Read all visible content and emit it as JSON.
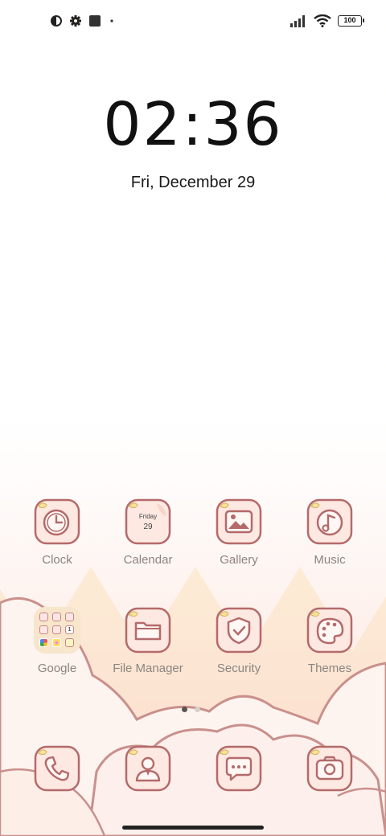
{
  "status_bar": {
    "battery": "100",
    "left_icons": [
      "theme-icon",
      "settings-icon",
      "stop-square-icon",
      "dot-icon"
    ],
    "right_icons": [
      "signal-icon",
      "wifi-icon",
      "battery-icon"
    ]
  },
  "lockscreen": {
    "time": "02:36",
    "date": "Fri, December 29"
  },
  "apps": [
    {
      "label": "Clock",
      "icon": "clock-icon"
    },
    {
      "label": "Calendar",
      "icon": "calendar-icon",
      "day_name": "Friday",
      "day_num": "29"
    },
    {
      "label": "Gallery",
      "icon": "gallery-icon"
    },
    {
      "label": "Music",
      "icon": "music-icon"
    },
    {
      "label": "Google",
      "icon": "folder-icon"
    },
    {
      "label": "File Manager",
      "icon": "folder-icon"
    },
    {
      "label": "Security",
      "icon": "shield-icon"
    },
    {
      "label": "Themes",
      "icon": "palette-icon"
    }
  ],
  "folder_badge": "1",
  "dock": [
    {
      "icon": "phone-icon"
    },
    {
      "icon": "contacts-icon"
    },
    {
      "icon": "messages-icon"
    },
    {
      "icon": "camera-icon"
    }
  ],
  "pages": {
    "count": 2,
    "active": 1
  },
  "colors": {
    "diamond_light": "#fdf0d4",
    "diamond_white": "#ffffff",
    "tile_pink": "#fbd9cf",
    "tile_border": "#b46a6a",
    "label_gray": "#8a8582",
    "cloud_fill": "#fdf0ec",
    "cloud_line": "#c9908c"
  }
}
